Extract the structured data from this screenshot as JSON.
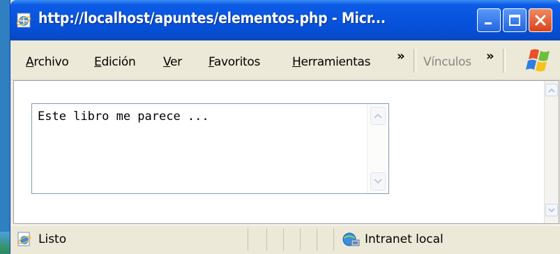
{
  "window": {
    "title": "http://localhost/apuntes/elementos.php - Micr...",
    "icon": "ie-page-icon"
  },
  "titlebar_buttons": {
    "minimize_icon": "minimize-icon",
    "maximize_icon": "maximize-icon",
    "close_icon": "close-icon"
  },
  "menu": {
    "items": [
      {
        "pre": "",
        "ul": "A",
        "post": "rchivo"
      },
      {
        "pre": "",
        "ul": "E",
        "post": "dición"
      },
      {
        "pre": "",
        "ul": "V",
        "post": "er"
      },
      {
        "pre": "",
        "ul": "F",
        "post": "avoritos"
      },
      {
        "pre": "",
        "ul": "H",
        "post": "erramientas"
      }
    ],
    "overflow_chevron": "»",
    "links_label": "Vínculos",
    "links_chevron": "»"
  },
  "textarea": {
    "value": "Este libro me parece ..."
  },
  "status": {
    "text": "Listo",
    "zone": "Intranet local"
  },
  "colors": {
    "titlebar": "#0a55de",
    "chrome": "#ece9d8",
    "close_button": "#d8431c"
  }
}
